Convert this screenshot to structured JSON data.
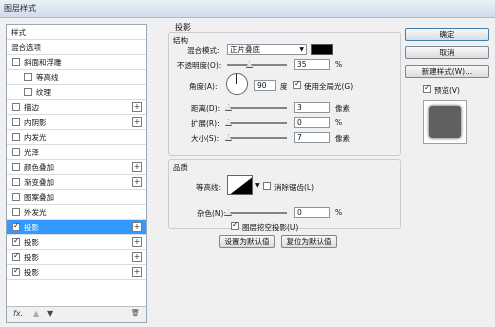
{
  "window": {
    "title": "图层样式"
  },
  "sidebar": {
    "header": "样式",
    "items": [
      {
        "label": "混合选项",
        "checkbox": false,
        "checked": false,
        "plus": false,
        "selected": false
      },
      {
        "label": "斜面和浮雕",
        "checkbox": true,
        "checked": false,
        "plus": false,
        "selected": false
      },
      {
        "label": "等高线",
        "checkbox": true,
        "checked": false,
        "plus": false,
        "selected": false,
        "indent": true
      },
      {
        "label": "纹理",
        "checkbox": true,
        "checked": false,
        "plus": false,
        "selected": false,
        "indent": true
      },
      {
        "label": "描边",
        "checkbox": true,
        "checked": false,
        "plus": true,
        "selected": false
      },
      {
        "label": "内阴影",
        "checkbox": true,
        "checked": false,
        "plus": true,
        "selected": false
      },
      {
        "label": "内发光",
        "checkbox": true,
        "checked": false,
        "plus": false,
        "selected": false
      },
      {
        "label": "光泽",
        "checkbox": true,
        "checked": false,
        "plus": false,
        "selected": false
      },
      {
        "label": "颜色叠加",
        "checkbox": true,
        "checked": false,
        "plus": true,
        "selected": false
      },
      {
        "label": "渐变叠加",
        "checkbox": true,
        "checked": false,
        "plus": true,
        "selected": false
      },
      {
        "label": "图案叠加",
        "checkbox": true,
        "checked": false,
        "plus": false,
        "selected": false
      },
      {
        "label": "外发光",
        "checkbox": true,
        "checked": false,
        "plus": false,
        "selected": false
      },
      {
        "label": "投影",
        "checkbox": true,
        "checked": true,
        "plus": true,
        "selected": true
      },
      {
        "label": "投影",
        "checkbox": true,
        "checked": true,
        "plus": true,
        "selected": false
      },
      {
        "label": "投影",
        "checkbox": true,
        "checked": true,
        "plus": true,
        "selected": false
      },
      {
        "label": "投影",
        "checkbox": true,
        "checked": true,
        "plus": true,
        "selected": false
      }
    ],
    "footer": {
      "fx": "fx.",
      "up": "▲",
      "down": "▼",
      "trash": "🗑"
    }
  },
  "panel": {
    "title": "投影",
    "structure": {
      "title": "结构",
      "blend_mode_label": "混合模式:",
      "blend_mode_value": "正片叠底",
      "color": "#000000",
      "opacity_label": "不透明度(O):",
      "opacity_value": "35",
      "opacity_unit": "%",
      "opacity_level": 0.35,
      "angle_label": "角度(A):",
      "angle_value": "90",
      "angle_unit": "度",
      "global_light_label": "使用全局光(G)",
      "global_light_checked": true,
      "distance_label": "距离(D):",
      "distance_value": "3",
      "distance_unit": "像素",
      "spread_label": "扩展(R):",
      "spread_value": "0",
      "spread_unit": "%",
      "size_label": "大小(S):",
      "size_value": "7",
      "size_unit": "像素"
    },
    "quality": {
      "title": "品质",
      "contour_label": "等高线:",
      "antialias_label": "消除锯齿(L)",
      "antialias_checked": false,
      "noise_label": "杂色(N):",
      "noise_value": "0",
      "noise_unit": "%"
    },
    "knockout_label": "图层挖空投影(U)",
    "knockout_checked": true,
    "set_default_label": "设置为默认值",
    "reset_default_label": "复位为默认值"
  },
  "actions": {
    "ok_label": "确定",
    "cancel_label": "取消",
    "new_style_label": "新建样式(W)...",
    "preview_label": "预览(V)",
    "preview_checked": true
  }
}
